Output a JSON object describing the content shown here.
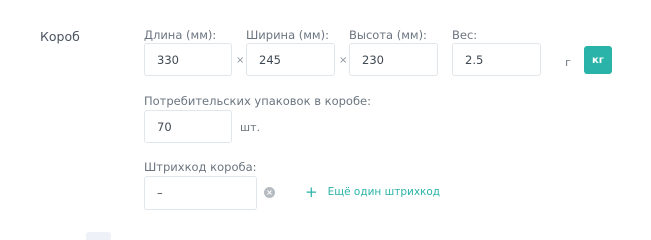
{
  "section": {
    "title": "Короб"
  },
  "dimensions": {
    "length": {
      "label": "Длина (мм):",
      "value": "330"
    },
    "width": {
      "label": "Ширина (мм):",
      "value": "245"
    },
    "height": {
      "label": "Высота (мм):",
      "value": "230"
    },
    "separator": "×"
  },
  "weight": {
    "label": "Вес:",
    "value": "2.5",
    "units": {
      "g": "г",
      "kg": "кг",
      "selected": "кг"
    }
  },
  "packages": {
    "label": "Потребительских упаковок в коробе:",
    "value": "70",
    "unit": "шт."
  },
  "barcode": {
    "label": "Штрихкод короба:",
    "value": "–",
    "add_label": "Ещё один штрихкод"
  },
  "colors": {
    "accent": "#2ab3a8",
    "border": "#e1e6ea"
  }
}
